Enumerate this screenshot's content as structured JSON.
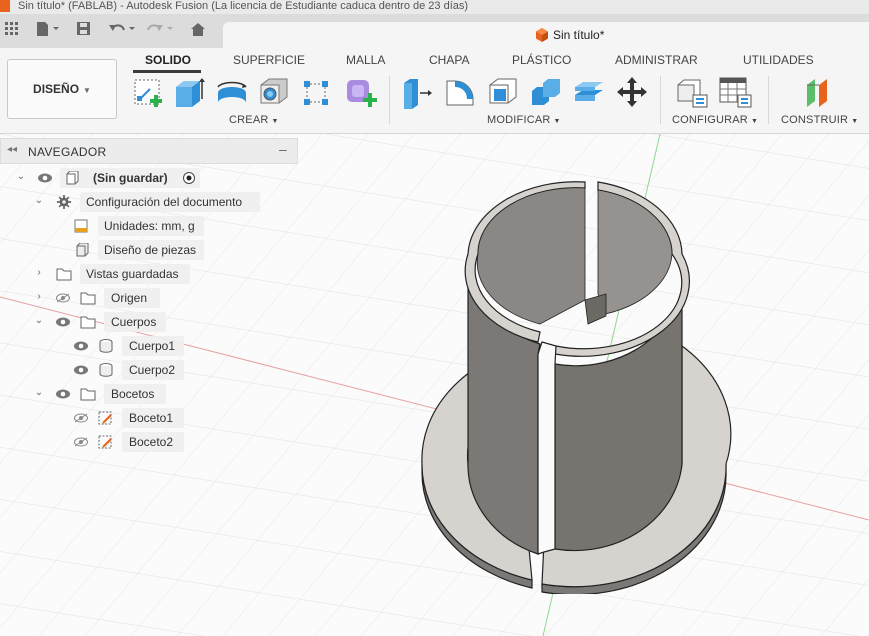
{
  "window": {
    "title": "Sin título* (FABLAB) - Autodesk Fusion (La licencia de Estudiante caduca dentro de 23 días)",
    "document_tab": "Sin título*"
  },
  "toolbar": {
    "workspace": "DISEÑO",
    "tabs": [
      "SOLIDO",
      "SUPERFICIE",
      "MALLA",
      "CHAPA",
      "PLÁSTICO",
      "ADMINISTRAR",
      "UTILIDADES"
    ],
    "active_tab": "SOLIDO",
    "groups": [
      "CREAR",
      "MODIFICAR",
      "CONFIGURAR",
      "CONSTRUIR"
    ]
  },
  "browser": {
    "title": "NAVEGADOR",
    "items": [
      {
        "label": "(Sin guardar)",
        "level": 0,
        "expanded": true
      },
      {
        "label": "Configuración del documento",
        "level": 1,
        "expanded": true
      },
      {
        "label": "Unidades: mm, g",
        "level": 2
      },
      {
        "label": "Diseño de piezas",
        "level": 2
      },
      {
        "label": "Vistas guardadas",
        "level": 1,
        "expanded": false
      },
      {
        "label": "Origen",
        "level": 1,
        "expanded": false,
        "visible": false
      },
      {
        "label": "Cuerpos",
        "level": 1,
        "expanded": true,
        "visible": true
      },
      {
        "label": "Cuerpo1",
        "level": 2,
        "visible": true
      },
      {
        "label": "Cuerpo2",
        "level": 2,
        "visible": true
      },
      {
        "label": "Bocetos",
        "level": 1,
        "expanded": true,
        "visible": true
      },
      {
        "label": "Boceto1",
        "level": 2,
        "visible": false
      },
      {
        "label": "Boceto2",
        "level": 2,
        "visible": false
      }
    ]
  },
  "colors": {
    "accent_orange": "#e8631c",
    "tool_blue": "#2e8fd6",
    "model_grey": "#7b7875",
    "model_light": "#d6d3cf",
    "axis_red": "#e05050",
    "axis_green": "#4cc24c"
  }
}
